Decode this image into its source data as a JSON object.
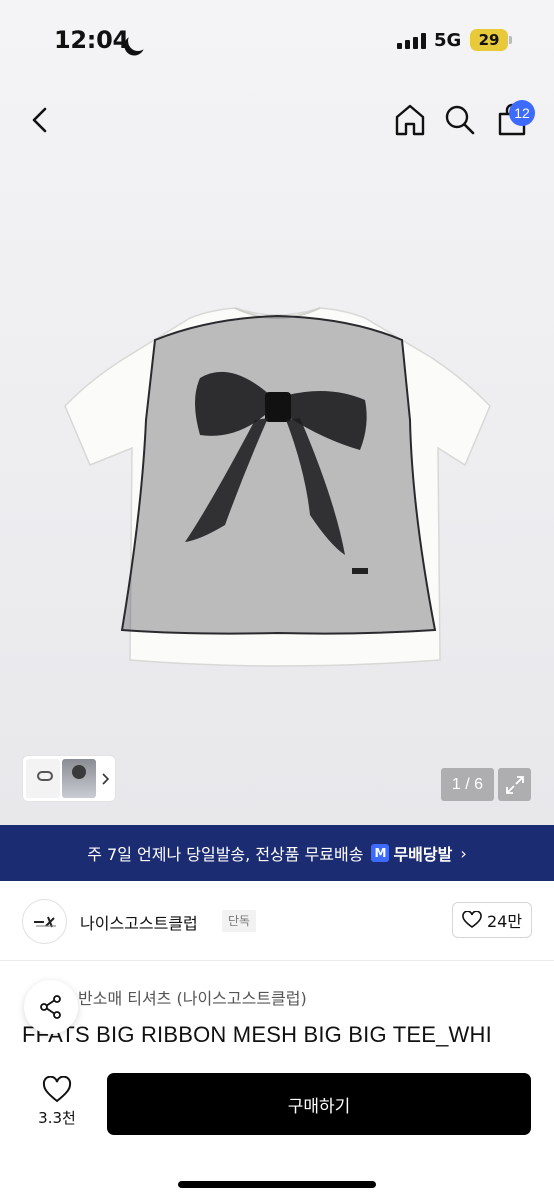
{
  "status_bar": {
    "time": "12:04",
    "network": "5G",
    "battery": "29"
  },
  "nav": {
    "cart_count": "12"
  },
  "gallery": {
    "page_counter": "1 / 6"
  },
  "promo": {
    "text": "주 7일 언제나 당일발송, 전상품 무료배송",
    "badge": "M",
    "brand": "무배당발",
    "arrow": "›"
  },
  "brand": {
    "name": "나이스고스트클럽",
    "tag": "단독",
    "likes": "24만"
  },
  "product": {
    "category": "반소매 티셔츠 (나이스고스트클럽)",
    "name": "FFATS BIG RIBBON MESH BIG BIG TEE_WHI"
  },
  "bottom": {
    "wish_count": "3.3천",
    "buy_label": "구매하기"
  },
  "colors": {
    "promo_bg": "#1b2c72",
    "accent_blue": "#3d6bff",
    "buy_bg": "#000000"
  },
  "icons": [
    "back-icon",
    "home-icon",
    "search-icon",
    "cart-icon",
    "expand-icon",
    "share-icon",
    "heart-icon",
    "moon-icon",
    "signal-icon",
    "battery-icon"
  ]
}
